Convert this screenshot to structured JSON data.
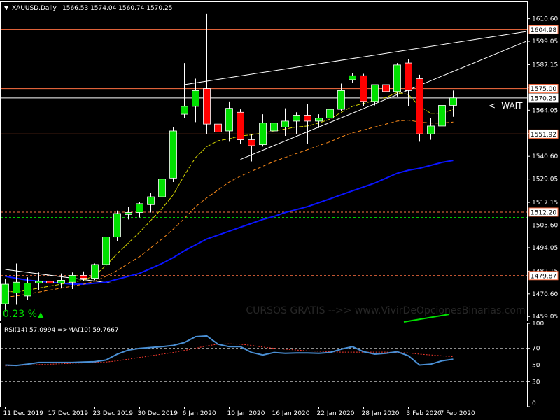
{
  "header": {
    "arrow": "▼",
    "symbol": "XAUUSD,Daily",
    "ohlc": "1566.53 1574.04 1560.74 1570.25"
  },
  "colors": {
    "bg": "#000000",
    "frame": "#ffffff",
    "bull": "#00e000",
    "bear": "#ff0000",
    "ma_fast": "#d6d600",
    "ma_mid": "#ff8c1a",
    "ma_slow": "#0a14ff",
    "hline": "#ff7043",
    "trend": "#ffffff",
    "rsi": "#4a8fd4",
    "rsi_ma": "#ff3b2f",
    "green_dash": "#00c800",
    "watermark": "#262626"
  },
  "annotations": {
    "wait": "<--WAIT",
    "watermark": "CURSOS GRATIS -->> www.VivirDeOpcionesBinarias.com",
    "percent": "0.23 %",
    "percent_arrow": "▲"
  },
  "chart_data": [
    {
      "type": "candlestick",
      "name": "XAUUSD,Daily",
      "ylim": [
        1457.0,
        1619.0
      ],
      "y_ticks": [
        "1610.60",
        "1599.05",
        "1587.15",
        "1575.60",
        "1564.05",
        "1552.15",
        "1540.60",
        "1529.05",
        "1517.15",
        "1505.60",
        "1494.05",
        "1482.15",
        "1470.60",
        "1459.05"
      ],
      "x_ticks": [
        {
          "label": "11 Dec 2019",
          "i": 0
        },
        {
          "label": "17 Dec 2019",
          "i": 4
        },
        {
          "label": "23 Dec 2019",
          "i": 8
        },
        {
          "label": "30 Dec 2019",
          "i": 12
        },
        {
          "label": "6 Jan 2020",
          "i": 16
        },
        {
          "label": "10 Jan 2020",
          "i": 20
        },
        {
          "label": "16 Jan 2020",
          "i": 24
        },
        {
          "label": "22 Jan 2020",
          "i": 28
        },
        {
          "label": "28 Jan 2020",
          "i": 32
        },
        {
          "label": "3 Feb 2020",
          "i": 36
        },
        {
          "label": "7 Feb 2020",
          "i": 39
        }
      ],
      "candles": [
        {
          "o": 1465.5,
          "h": 1478.0,
          "l": 1461.5,
          "c": 1475.5
        },
        {
          "o": 1471.0,
          "h": 1486.0,
          "l": 1465.0,
          "c": 1476.5
        },
        {
          "o": 1469.5,
          "h": 1479.0,
          "l": 1467.5,
          "c": 1476.0
        },
        {
          "o": 1476.0,
          "h": 1481.5,
          "l": 1472.5,
          "c": 1477.0
        },
        {
          "o": 1477.0,
          "h": 1479.5,
          "l": 1473.0,
          "c": 1476.0
        },
        {
          "o": 1476.0,
          "h": 1481.0,
          "l": 1473.5,
          "c": 1477.5
        },
        {
          "o": 1476.5,
          "h": 1481.5,
          "l": 1473.0,
          "c": 1480.0
        },
        {
          "o": 1480.0,
          "h": 1482.0,
          "l": 1477.0,
          "c": 1478.5
        },
        {
          "o": 1478.5,
          "h": 1486.0,
          "l": 1477.5,
          "c": 1485.5
        },
        {
          "o": 1485.5,
          "h": 1500.5,
          "l": 1484.0,
          "c": 1499.5
        },
        {
          "o": 1499.5,
          "h": 1513.0,
          "l": 1497.5,
          "c": 1511.5
        },
        {
          "o": 1511.0,
          "h": 1515.0,
          "l": 1508.5,
          "c": 1512.0
        },
        {
          "o": 1512.0,
          "h": 1517.5,
          "l": 1509.5,
          "c": 1516.5
        },
        {
          "o": 1516.0,
          "h": 1522.0,
          "l": 1512.0,
          "c": 1520.0
        },
        {
          "o": 1520.0,
          "h": 1531.0,
          "l": 1518.5,
          "c": 1529.0
        },
        {
          "o": 1529.5,
          "h": 1555.5,
          "l": 1527.5,
          "c": 1553.5
        },
        {
          "o": 1562.0,
          "h": 1588.0,
          "l": 1560.0,
          "c": 1566.0
        },
        {
          "o": 1566.0,
          "h": 1580.0,
          "l": 1558.0,
          "c": 1574.0
        },
        {
          "o": 1575.0,
          "h": 1613.0,
          "l": 1552.0,
          "c": 1557.0
        },
        {
          "o": 1557.0,
          "h": 1567.0,
          "l": 1545.0,
          "c": 1553.0
        },
        {
          "o": 1553.5,
          "h": 1568.5,
          "l": 1548.0,
          "c": 1565.0
        },
        {
          "o": 1563.0,
          "h": 1564.5,
          "l": 1547.0,
          "c": 1549.0
        },
        {
          "o": 1549.0,
          "h": 1552.0,
          "l": 1538.0,
          "c": 1546.0
        },
        {
          "o": 1546.5,
          "h": 1562.0,
          "l": 1545.5,
          "c": 1557.5
        },
        {
          "o": 1553.5,
          "h": 1560.5,
          "l": 1549.0,
          "c": 1557.5
        },
        {
          "o": 1555.5,
          "h": 1565.0,
          "l": 1551.0,
          "c": 1558.5
        },
        {
          "o": 1558.5,
          "h": 1563.0,
          "l": 1552.0,
          "c": 1561.5
        },
        {
          "o": 1561.5,
          "h": 1567.0,
          "l": 1547.0,
          "c": 1558.5
        },
        {
          "o": 1558.5,
          "h": 1562.0,
          "l": 1555.0,
          "c": 1560.0
        },
        {
          "o": 1560.0,
          "h": 1570.5,
          "l": 1558.0,
          "c": 1564.5
        },
        {
          "o": 1564.5,
          "h": 1577.5,
          "l": 1563.5,
          "c": 1574.0
        },
        {
          "o": 1579.5,
          "h": 1583.0,
          "l": 1578.0,
          "c": 1581.5
        },
        {
          "o": 1581.5,
          "h": 1582.5,
          "l": 1566.0,
          "c": 1568.5
        },
        {
          "o": 1568.5,
          "h": 1575.5,
          "l": 1566.5,
          "c": 1577.0
        },
        {
          "o": 1577.0,
          "h": 1580.0,
          "l": 1570.5,
          "c": 1573.5
        },
        {
          "o": 1573.5,
          "h": 1588.0,
          "l": 1571.0,
          "c": 1587.0
        },
        {
          "o": 1588.0,
          "h": 1590.0,
          "l": 1566.0,
          "c": 1574.0
        },
        {
          "o": 1580.0,
          "h": 1582.0,
          "l": 1548.0,
          "c": 1552.0
        },
        {
          "o": 1552.0,
          "h": 1560.0,
          "l": 1549.0,
          "c": 1556.0
        },
        {
          "o": 1556.0,
          "h": 1568.0,
          "l": 1554.0,
          "c": 1566.5
        },
        {
          "o": 1566.5,
          "h": 1574.0,
          "l": 1560.7,
          "c": 1570.3
        }
      ],
      "ma_fast": [
        1472.0,
        1471.5,
        1472.5,
        1473.5,
        1474.5,
        1475.5,
        1476.5,
        1477.5,
        1480.0,
        1485.0,
        1491.0,
        1496.5,
        1502.0,
        1508.0,
        1514.0,
        1521.0,
        1531.0,
        1540.0,
        1545.5,
        1548.5,
        1549.5,
        1551.0,
        1551.5,
        1552.5,
        1553.5,
        1554.5,
        1555.5,
        1556.0,
        1557.5,
        1559.5,
        1563.0,
        1566.0,
        1567.5,
        1569.0,
        1570.5,
        1573.0,
        1572.0,
        1566.0,
        1562.5,
        1562.5,
        1564.5
      ],
      "ma_mid": [
        1469.0,
        1469.5,
        1470.5,
        1471.5,
        1472.5,
        1473.5,
        1474.5,
        1475.5,
        1477.0,
        1479.5,
        1482.5,
        1486.0,
        1489.5,
        1494.0,
        1498.5,
        1503.5,
        1509.0,
        1515.0,
        1519.5,
        1523.5,
        1527.5,
        1530.5,
        1533.0,
        1535.5,
        1538.0,
        1540.0,
        1542.0,
        1544.0,
        1546.0,
        1548.0,
        1550.5,
        1552.5,
        1554.0,
        1555.5,
        1557.0,
        1558.5,
        1559.0,
        1558.0,
        1557.5,
        1557.5,
        1558.0
      ],
      "ma_slow": [
        1479.5,
        1478.5,
        1477.5,
        1477.0,
        1476.5,
        1476.0,
        1475.5,
        1475.5,
        1476.0,
        1476.5,
        1478.0,
        1479.5,
        1481.0,
        1483.5,
        1486.0,
        1489.0,
        1492.5,
        1495.5,
        1498.5,
        1500.5,
        1502.5,
        1504.5,
        1506.5,
        1508.5,
        1510.0,
        1512.0,
        1513.5,
        1515.0,
        1517.0,
        1519.0,
        1521.0,
        1523.0,
        1525.0,
        1527.0,
        1529.5,
        1532.0,
        1533.5,
        1534.5,
        1536.0,
        1537.5,
        1538.5
      ],
      "h_levels": [
        {
          "value": 1604.98,
          "label": "1604.98",
          "tag": true,
          "color": "#ff7043",
          "dash": false
        },
        {
          "value": 1575.0,
          "label": "1575.00",
          "tag": true,
          "color": "#ff7043",
          "dash": false
        },
        {
          "value": 1570.25,
          "label": "1570.25",
          "tag": true,
          "color": "#ffffff",
          "dash": false,
          "current": true
        },
        {
          "value": 1551.92,
          "label": "1551.92",
          "tag": true,
          "color": "#ff7043",
          "dash": false
        },
        {
          "value": 1512.2,
          "label": "1512.20",
          "tag": true,
          "color": "#ff7043",
          "dash": true
        },
        {
          "value": 1509.5,
          "label": "",
          "tag": false,
          "color": "#00c800",
          "dash": true
        },
        {
          "value": 1479.87,
          "label": "1479.87",
          "tag": true,
          "color": "#ff7043",
          "dash": true
        }
      ],
      "trend_lines": [
        {
          "x1": 16.0,
          "y1": 1577.0,
          "x2": 46.5,
          "y2": 1604.0
        },
        {
          "x1": 21.0,
          "y1": 1539.0,
          "x2": 46.5,
          "y2": 1599.0
        },
        {
          "x1": 0.0,
          "y1": 1483.0,
          "x2": 9.5,
          "y2": 1476.0
        }
      ]
    },
    {
      "type": "line",
      "name": "RSI(14)",
      "title": "RSI(14) 57.0994  =>MA(10) 59.7667",
      "ylim": [
        0,
        100
      ],
      "y_ticks": [
        "100",
        "70",
        "50",
        "30",
        "0"
      ],
      "levels": [
        70,
        50,
        30
      ],
      "series": [
        {
          "name": "RSI(14)",
          "color": "#4a8fd4",
          "values": [
            50,
            49.5,
            51,
            53,
            53,
            53,
            53,
            53.5,
            54,
            56,
            63,
            68,
            70,
            71,
            72,
            73.5,
            77,
            84,
            85,
            75,
            72,
            72,
            65,
            62,
            65,
            64,
            64.5,
            64.5,
            64,
            65,
            69,
            72,
            66,
            63,
            64,
            66,
            61,
            50,
            51,
            55,
            57
          ]
        },
        {
          "name": "MA(10)",
          "color": "#ff3b2f",
          "values": [
            49,
            49.5,
            50,
            50.5,
            51,
            51.5,
            52,
            52.5,
            53,
            53.5,
            55,
            57,
            59,
            61,
            63,
            65,
            67.5,
            70,
            73,
            75,
            75.5,
            75,
            73.5,
            71.5,
            70,
            69,
            68,
            67,
            66.5,
            66,
            65.5,
            65.5,
            65.5,
            65.5,
            65.5,
            65,
            64.5,
            63,
            62,
            61,
            60
          ]
        }
      ]
    }
  ]
}
